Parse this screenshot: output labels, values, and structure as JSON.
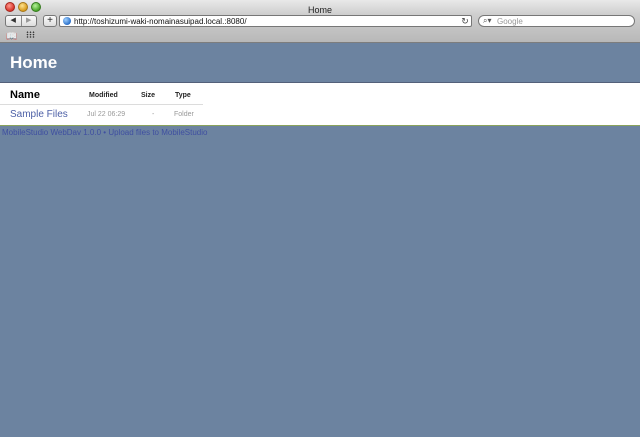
{
  "window": {
    "title": "Home"
  },
  "toolbar": {
    "back": "◀",
    "forward": "▶",
    "add": "+",
    "url": "http://toshizumi-waki-nomainasuipad.local.:8080/",
    "reload": "↻",
    "search_placeholder": "Google"
  },
  "page": {
    "title": "Home",
    "table": {
      "headers": {
        "name": "Name",
        "modified": "Modified",
        "size": "Size",
        "type": "Type"
      },
      "rows": [
        {
          "name": "Sample Files",
          "modified": "Jul 22 06:29",
          "size": "-",
          "type": "Folder"
        }
      ]
    },
    "footer": {
      "app": "MobileStudio WebDav 1.0.0",
      "separator": "•",
      "upload": "Upload files to MobileStudio"
    }
  },
  "colors": {
    "page_background": "#6c83a0",
    "link": "#4c5fa6",
    "footer_link": "#3f4fa0"
  }
}
